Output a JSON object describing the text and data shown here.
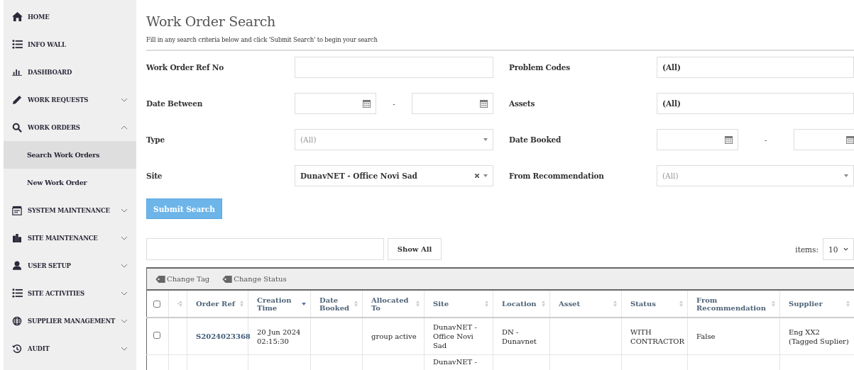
{
  "sidebar": {
    "items": [
      {
        "label": "HOME"
      },
      {
        "label": "INFO WALL"
      },
      {
        "label": "DASHBOARD"
      },
      {
        "label": "WORK REQUESTS",
        "expanded": false
      },
      {
        "label": "WORK ORDERS",
        "expanded": true,
        "children": [
          {
            "label": "Search Work Orders",
            "selected": true
          },
          {
            "label": "New Work Order",
            "selected": false
          }
        ]
      },
      {
        "label": "SYSTEM MAINTENANCE",
        "expanded": false
      },
      {
        "label": "SITE MAINTENANCE",
        "expanded": false
      },
      {
        "label": "USER SETUP",
        "expanded": false
      },
      {
        "label": "SITE ACTIVITIES",
        "expanded": false
      },
      {
        "label": "SUPPLIER MANAGEMENT",
        "expanded": false
      },
      {
        "label": "AUDIT",
        "expanded": false
      }
    ]
  },
  "page": {
    "title": "Work Order Search",
    "subtitle": "Fill in any search criteria below and click 'Submit Search' to begin your search"
  },
  "form": {
    "rows": [
      {
        "left": {
          "label": "Work Order Ref No",
          "kind": "text"
        },
        "right": {
          "label": "Problem Codes",
          "kind": "multi",
          "value": "(All)"
        }
      },
      {
        "left": {
          "label": "Date Between",
          "kind": "date_range",
          "separator": "-"
        },
        "right": {
          "label": "Assets",
          "kind": "multi",
          "value": "(All)"
        }
      },
      {
        "left": {
          "label": "Type",
          "kind": "select",
          "placeholder": "(All)"
        },
        "right": {
          "label": "Date Booked",
          "kind": "date_range",
          "separator": "-"
        }
      },
      {
        "left": {
          "label": "Site",
          "kind": "select",
          "value": "DunavNET - Office Novi Sad",
          "clearable": true
        },
        "right": {
          "label": "From Recommendation",
          "kind": "select",
          "placeholder": "(All)"
        }
      }
    ],
    "submit": "Submit Search"
  },
  "results": {
    "show_all": "Show All",
    "items_label": "items:",
    "items_value": "10",
    "toolbar": [
      "Change Tag",
      "Change Status"
    ],
    "columns": [
      {
        "kind": "checkbox",
        "checked": false
      },
      {
        "kind": "attachment",
        "sorted": false
      },
      {
        "label": "Order Ref",
        "sorted": false
      },
      {
        "label": "Creation Time",
        "sorted": true
      },
      {
        "label": "Date Booked",
        "sorted": false
      },
      {
        "label": "Allocated To",
        "sorted": false
      },
      {
        "label": "Site",
        "sorted": false
      },
      {
        "label": "Location",
        "sorted": false
      },
      {
        "label": "Asset",
        "sorted": false
      },
      {
        "label": "Status",
        "sorted": false
      },
      {
        "label": "From Recommendation",
        "sorted": false
      },
      {
        "label": "Supplier",
        "sorted": false
      }
    ],
    "rows": [
      {
        "checked": false,
        "cells": [
          "",
          "",
          "S2024023368",
          "20 Jun 2024 02:15:30",
          "",
          "group active",
          "DunavNET - Office Novi Sad",
          "DN - Dunavnet",
          "",
          "WITH CONTRACTOR",
          "False",
          "Eng XX2 (Tagged Suplier)"
        ]
      },
      {
        "cells": [
          "",
          "",
          "",
          "",
          "",
          "",
          "DunavNET -",
          "",
          "",
          "",
          "",
          ""
        ]
      }
    ]
  }
}
